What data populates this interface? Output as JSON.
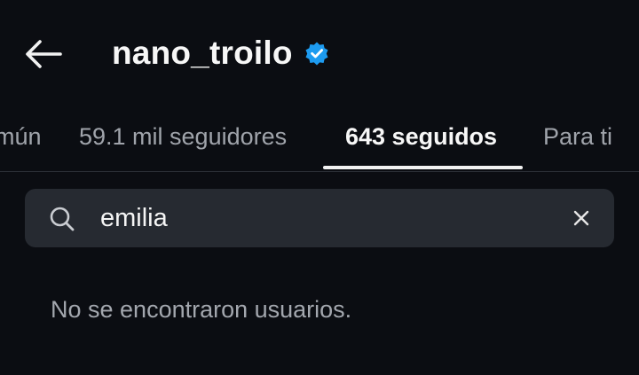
{
  "header": {
    "back_icon": "arrow-left-icon",
    "username": "nano_troilo",
    "verified_icon": "verified-badge-icon",
    "verified_color": "#1d9bf0"
  },
  "tabs": [
    {
      "label": "mún",
      "active": false
    },
    {
      "label": "59.1 mil seguidores",
      "active": false
    },
    {
      "label": "643 seguidos",
      "active": true
    },
    {
      "label": "Para ti",
      "active": false
    }
  ],
  "search": {
    "icon": "search-icon",
    "value": "emilia",
    "clear_icon": "close-icon"
  },
  "results": {
    "empty_message": "No se encontraron usuarios."
  }
}
